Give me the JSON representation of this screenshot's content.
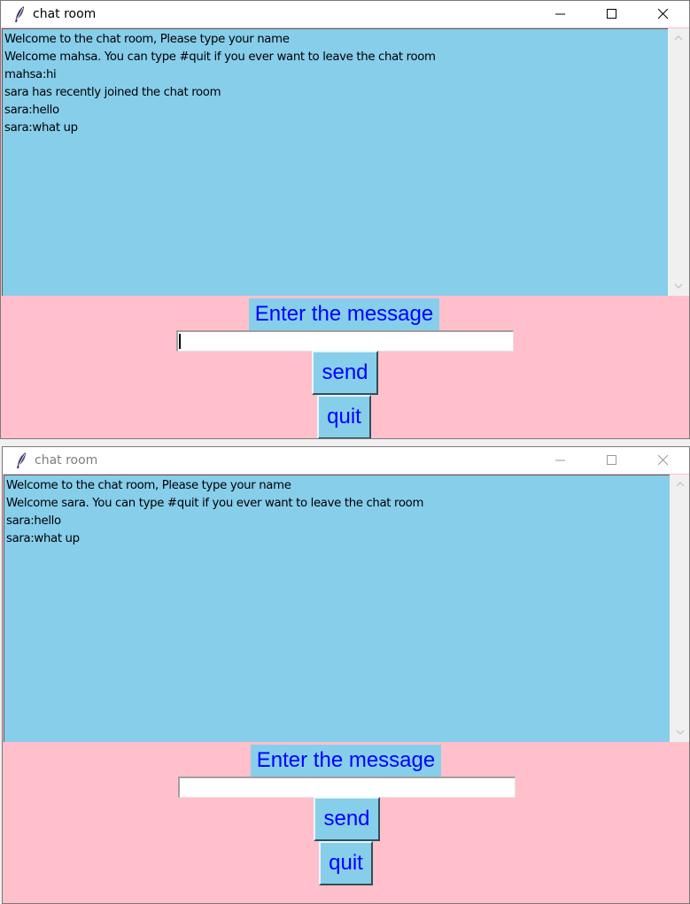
{
  "windows": [
    {
      "title": "chat room",
      "active": true,
      "messages": [
        "Welcome to the chat room, Please type your name",
        "Welcome mahsa. You can type #quit if you ever want to leave the chat room",
        "mahsa:hi",
        "sara has recently joined the chat room",
        "sara:hello",
        "sara:what up"
      ],
      "prompt_label": "Enter the message",
      "entry_value": "",
      "send_label": "send",
      "quit_label": "quit"
    },
    {
      "title": "chat room",
      "active": false,
      "messages": [
        "Welcome to the chat room, Please type your name",
        "Welcome sara. You can type #quit if you ever want to leave the chat room",
        "sara:hello",
        "sara:what up"
      ],
      "prompt_label": "Enter the message",
      "entry_value": "",
      "send_label": "send",
      "quit_label": "quit"
    }
  ],
  "icons": {
    "app": "feather-icon",
    "minimize": "minimize-icon",
    "maximize": "maximize-icon",
    "close": "close-icon",
    "scroll_up": "chevron-up-icon",
    "scroll_down": "chevron-down-icon"
  },
  "colors": {
    "chat_background": "#87ceeb",
    "window_background": "#ffc0cb",
    "button_text": "#0000ff"
  }
}
